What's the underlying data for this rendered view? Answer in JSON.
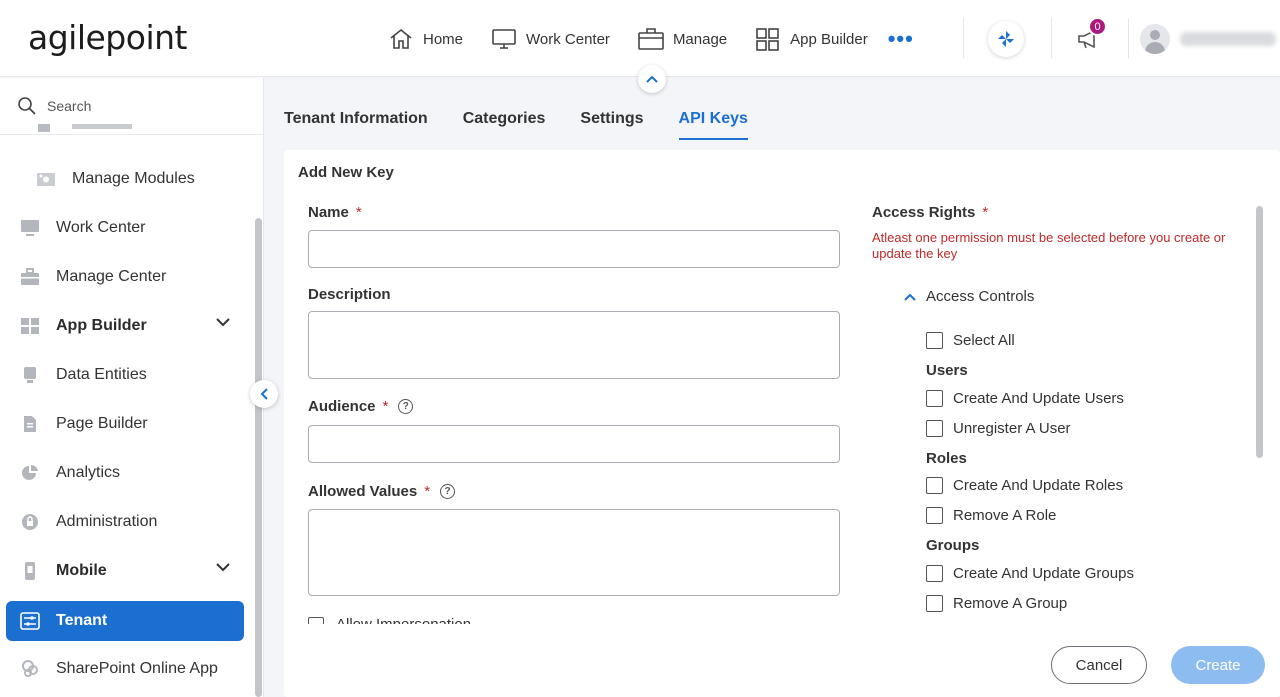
{
  "header": {
    "logo": "agilepoint",
    "nav": [
      {
        "label": "Home",
        "icon": "home-icon"
      },
      {
        "label": "Work Center",
        "icon": "monitor-icon"
      },
      {
        "label": "Manage",
        "icon": "briefcase-icon"
      },
      {
        "label": "App Builder",
        "icon": "grid-icon"
      }
    ],
    "more_label": "•••",
    "notifications_count": "0"
  },
  "sidebar": {
    "search_placeholder": "Search",
    "items": [
      {
        "label": "Manage Modules",
        "icon": "modules-icon"
      },
      {
        "label": "Work Center",
        "icon": "monitor-icon"
      },
      {
        "label": "Manage Center",
        "icon": "briefcase-icon"
      },
      {
        "label": "App Builder",
        "icon": "app-builder-icon"
      },
      {
        "label": "Data Entities",
        "icon": "data-entities-icon"
      },
      {
        "label": "Page Builder",
        "icon": "page-builder-icon"
      },
      {
        "label": "Analytics",
        "icon": "pie-chart-icon"
      },
      {
        "label": "Administration",
        "icon": "lock-icon"
      },
      {
        "label": "Mobile",
        "icon": "mobile-icon"
      },
      {
        "label": "Tenant",
        "icon": "tenant-icon"
      },
      {
        "label": "SharePoint Online App",
        "icon": "sharepoint-icon"
      }
    ]
  },
  "tabs": [
    "Tenant Information",
    "Categories",
    "Settings",
    "API Keys"
  ],
  "active_tab": "API Keys",
  "form": {
    "title": "Add New Key",
    "name_label": "Name",
    "description_label": "Description",
    "audience_label": "Audience",
    "allowed_values_label": "Allowed Values",
    "required_mark": "*",
    "partial_option": "Allow Impersonation"
  },
  "access": {
    "label": "Access Rights",
    "error": "Atleast one permission must be selected before you create or update the key",
    "section": "Access Controls",
    "select_all": "Select All",
    "groups": [
      {
        "name": "Users",
        "items": [
          "Create And Update Users",
          "Unregister A User"
        ]
      },
      {
        "name": "Roles",
        "items": [
          "Create And Update Roles",
          "Remove A Role"
        ]
      },
      {
        "name": "Groups",
        "items": [
          "Create And Update Groups",
          "Remove A Group"
        ]
      }
    ]
  },
  "buttons": {
    "cancel": "Cancel",
    "create": "Create"
  },
  "colors": {
    "accent": "#1b6fd1",
    "error": "#c02a2a",
    "badge": "#b0177c",
    "create_disabled": "#8dbdf0"
  }
}
